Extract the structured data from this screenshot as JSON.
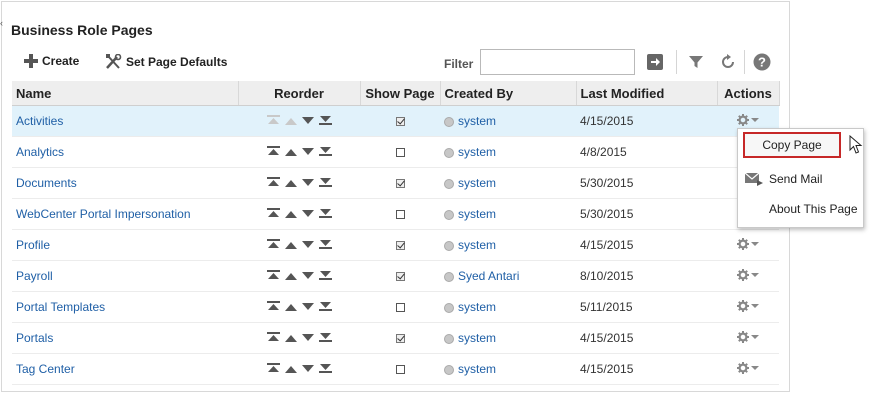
{
  "title": "Business Role Pages",
  "toolbar": {
    "create_label": "Create",
    "set_defaults_label": "Set Page Defaults",
    "filter_label": "Filter",
    "filter_value": ""
  },
  "columns": {
    "name": "Name",
    "reorder": "Reorder",
    "show_page": "Show Page",
    "created_by": "Created By",
    "last_modified": "Last Modified",
    "actions": "Actions"
  },
  "rows": [
    {
      "name": "Activities",
      "show_page": true,
      "created_by": "system",
      "last_modified": "4/15/2015",
      "selected": true
    },
    {
      "name": "Analytics",
      "show_page": false,
      "created_by": "system",
      "last_modified": "4/8/2015"
    },
    {
      "name": "Documents",
      "show_page": true,
      "created_by": "system",
      "last_modified": "5/30/2015"
    },
    {
      "name": "WebCenter Portal Impersonation",
      "show_page": false,
      "created_by": "system",
      "last_modified": "5/30/2015"
    },
    {
      "name": "Profile",
      "show_page": true,
      "created_by": "system",
      "last_modified": "4/15/2015"
    },
    {
      "name": "Payroll",
      "show_page": true,
      "created_by": "Syed Antari",
      "last_modified": "8/10/2015"
    },
    {
      "name": "Portal Templates",
      "show_page": false,
      "created_by": "system",
      "last_modified": "5/11/2015"
    },
    {
      "name": "Portals",
      "show_page": true,
      "created_by": "system",
      "last_modified": "4/15/2015"
    },
    {
      "name": "Tag Center",
      "show_page": false,
      "created_by": "system",
      "last_modified": "4/15/2015"
    }
  ],
  "actions_menu": {
    "copy_page": "Copy Page",
    "send_mail": "Send Mail",
    "about_page": "About This Page"
  },
  "icons": {
    "create": "plus-icon",
    "set_defaults": "wrench-screwdriver-icon",
    "filter_go": "arrow-right-icon",
    "filter": "funnel-icon",
    "refresh": "refresh-icon",
    "help": "help-icon",
    "actions": "gear-icon"
  },
  "colors": {
    "link": "#1f5fa6",
    "selected_row": "#e1f2fb",
    "menu_highlight_border": "#c62828"
  }
}
